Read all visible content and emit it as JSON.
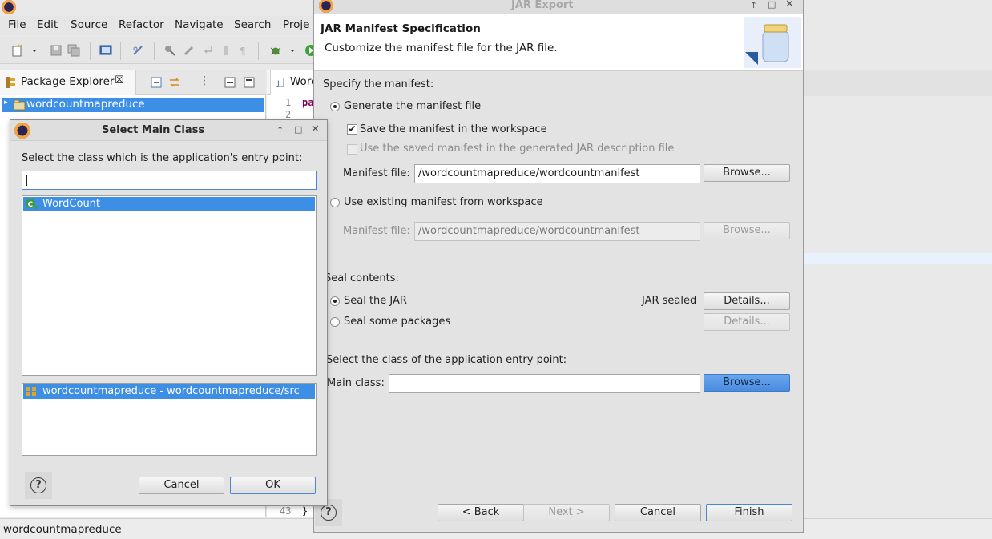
{
  "workbench": {
    "menu": [
      "File",
      "Edit",
      "Source",
      "Refactor",
      "Navigate",
      "Search",
      "Proje"
    ],
    "package_explorer": {
      "tab_label": "Package Explorer",
      "tree_item": "wordcountmapreduce"
    },
    "editor": {
      "tab_label": "Word",
      "line_numbers": [
        "1",
        "2",
        "43"
      ],
      "code_fragment": "pa",
      "closing_brace": "}"
    },
    "status_text": "wordcountmapreduce"
  },
  "jar_export": {
    "window_title": "JAR Export",
    "banner_title": "JAR Manifest Specification",
    "banner_subtitle": "Customize the manifest file for the JAR file.",
    "specify_manifest_label": "Specify the manifest:",
    "generate_manifest": {
      "label": "Generate the manifest file",
      "selected": true
    },
    "save_manifest": {
      "label": "Save the manifest in the workspace",
      "checked": true
    },
    "use_saved_manifest": {
      "label": "Use the saved manifest in the generated JAR description file",
      "checked": false,
      "enabled": false
    },
    "manifest_file_label": "Manifest file:",
    "manifest_file_value": "/wordcountmapreduce/wordcountmanifest",
    "browse_label": "Browse...",
    "use_existing": {
      "label": "Use existing manifest from workspace",
      "selected": false
    },
    "existing_manifest_file_label": "Manifest file:",
    "existing_manifest_file_value": "/wordcountmapreduce/wordcountmanifest",
    "seal_contents_label": "Seal contents:",
    "seal_jar": {
      "label": "Seal the JAR",
      "selected": true
    },
    "jar_sealed_status": "JAR sealed",
    "details_label": "Details...",
    "seal_some": {
      "label": "Seal some packages",
      "selected": false
    },
    "entry_point_label": "Select the class of the application entry point:",
    "main_class_label": "Main class:",
    "main_class_value": "",
    "buttons": {
      "back": "< Back",
      "next": "Next >",
      "cancel": "Cancel",
      "finish": "Finish"
    }
  },
  "select_main_class": {
    "window_title": "Select Main Class",
    "prompt": "Select the class which is the application's entry point:",
    "filter_value": "",
    "classes": [
      "WordCount"
    ],
    "packages": [
      "wordcountmapreduce - wordcountmapreduce/src"
    ],
    "buttons": {
      "cancel": "Cancel",
      "ok": "OK"
    }
  },
  "colors": {
    "selection": "#3d8ee5",
    "dialog_bg": "#e3e3e3",
    "banner_bg": "#ffffff"
  }
}
